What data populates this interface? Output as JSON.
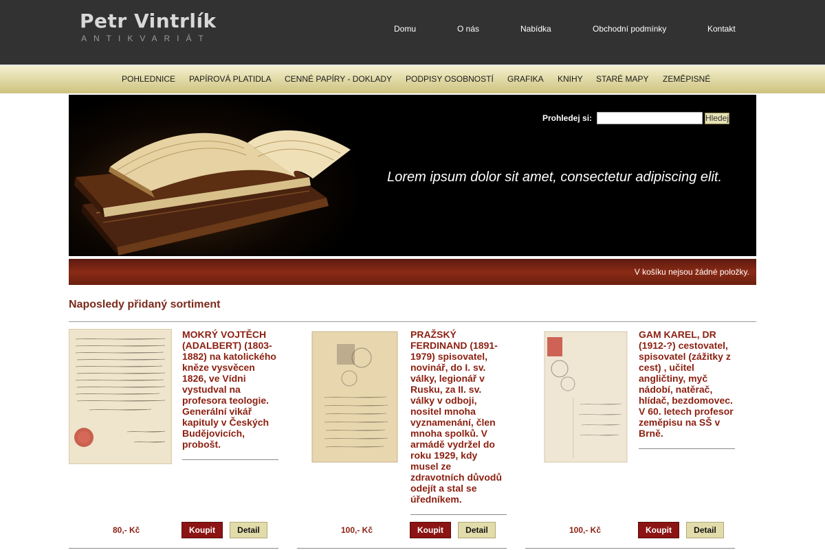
{
  "logo": {
    "name": "Petr Vintrlík",
    "subtitle": "ANTIKVARIÁT"
  },
  "topnav": [
    "Domu",
    "O nás",
    "Nabídka",
    "Obchodní podmínky",
    "Kontakt"
  ],
  "categories": [
    "POHLEDNICE",
    "PAPÍROVÁ PLATIDLA",
    "CENNÉ PAPÍRY - DOKLADY",
    "PODPISY OSOBNOSTÍ",
    "GRAFIKA",
    "KNIHY",
    "STARÉ MAPY",
    "ZEMĚPISNÉ"
  ],
  "hero": {
    "search_label": "Prohledej si:",
    "search_value": "",
    "search_button": "Hledej",
    "tagline": "Lorem ipsum dolor sit amet, consectetur adipiscing elit."
  },
  "cart": {
    "status": "V košíku nejsou žádné položky."
  },
  "section": {
    "title": "Naposledy přidaný sortiment"
  },
  "products": [
    {
      "title": "MOKRÝ VOJTĚCH (ADALBERT) (1803-1882) na katolického kněze vysvěcen 1826, ve Vídni vystudval na profesora teologie. Generální vikář kapituly v Českých Budějovicích, probošt.",
      "price": "80,- Kč",
      "buy": "Koupit",
      "detail": "Detail"
    },
    {
      "title": "PRAŽSKÝ FERDINAND (1891-1979) spisovatel, novinář, do I. sv. války, legionář v Rusku, za II. sv. války v odboji, nositel mnoha vyznamenání, člen mnoha spolků. V armádě vydržel do roku 1929, kdy musel ze zdravotních důvodů odejít a stal se úředníkem.",
      "price": "100,- Kč",
      "buy": "Koupit",
      "detail": "Detail"
    },
    {
      "title": "GAM KAREL, DR (1912-?) cestovatel, spisovatel (zážitky z cest) , učitel angličtiny, myč nádobí, natěrač, hlídač, bezdomovec. V 60. letech profesor zeměpisu na SŠ v Brně.",
      "price": "100,- Kč",
      "buy": "Koupit",
      "detail": "Detail"
    }
  ]
}
